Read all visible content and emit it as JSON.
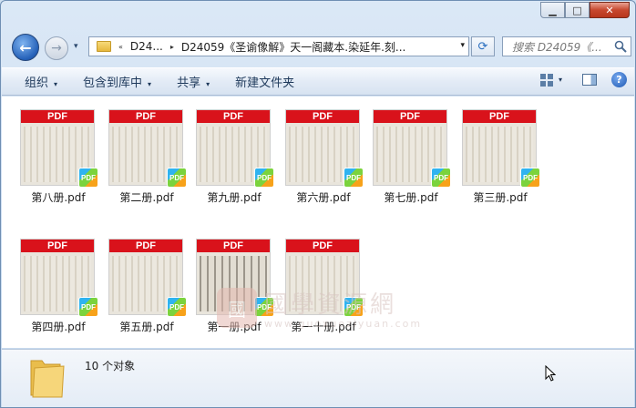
{
  "window": {
    "minimize_glyph": "▁",
    "maximize_glyph": "□",
    "close_glyph": "✕"
  },
  "nav": {
    "back_glyph": "←",
    "forward_glyph": "→",
    "history_glyph": "▾",
    "breadcrumb_prefix": "«",
    "breadcrumb_1": "D24...",
    "breadcrumb_sep": "▸",
    "breadcrumb_2": "D24059《圣谕像解》天一阁藏本.染延年.刻...",
    "dropdown_glyph": "▾",
    "refresh_glyph": "⟳",
    "search_placeholder": "搜索 D24059《..."
  },
  "toolbar": {
    "organize": "组织",
    "include_in_library": "包含到库中",
    "share": "共享",
    "new_folder": "新建文件夹",
    "caret": "▾",
    "help_glyph": "?"
  },
  "files": [
    {
      "name": "第八册.pdf",
      "thumb_label": "PDF",
      "badge": "PDF"
    },
    {
      "name": "第二册.pdf",
      "thumb_label": "PDF",
      "badge": "PDF"
    },
    {
      "name": "第九册.pdf",
      "thumb_label": "PDF",
      "badge": "PDF"
    },
    {
      "name": "第六册.pdf",
      "thumb_label": "PDF",
      "badge": "PDF"
    },
    {
      "name": "第七册.pdf",
      "thumb_label": "PDF",
      "badge": "PDF"
    },
    {
      "name": "第三册.pdf",
      "thumb_label": "PDF",
      "badge": "PDF"
    },
    {
      "name": "第四册.pdf",
      "thumb_label": "PDF",
      "badge": "PDF"
    },
    {
      "name": "第五册.pdf",
      "thumb_label": "PDF",
      "badge": "PDF"
    },
    {
      "name": "第一册.pdf",
      "thumb_label": "PDF",
      "badge": "PDF"
    },
    {
      "name": "第一十册.pdf",
      "thumb_label": "PDF",
      "badge": "PDF"
    }
  ],
  "watermark": {
    "title": "國學資源網",
    "url": "www.guoxueziyuan.com"
  },
  "status": {
    "count_text": "10 个对象"
  },
  "colors": {
    "pdf_red": "#d9121b",
    "accent_blue": "#1e395b"
  }
}
